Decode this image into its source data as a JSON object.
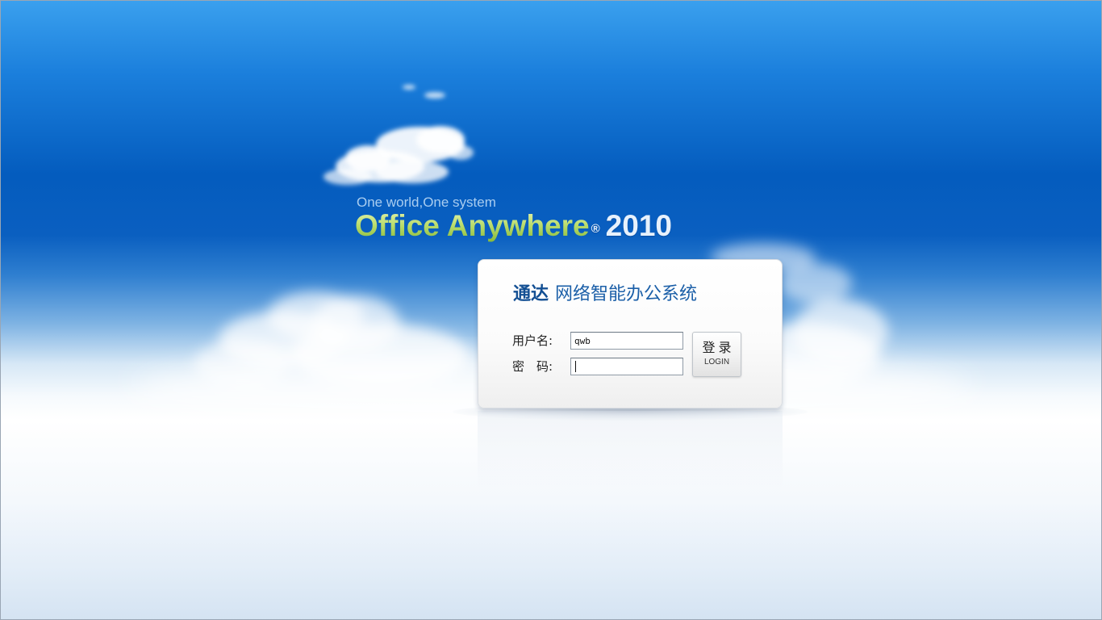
{
  "brand": {
    "tagline": "One world,One system",
    "product_name": "Office Anywhere",
    "registered_mark": "®",
    "year": "2010"
  },
  "login_card": {
    "title_brand": "通达",
    "title_system": "网络智能办公系统",
    "username_label": "用户名:",
    "password_label": "密　码:",
    "username_value": "qwb",
    "password_value": "",
    "login_button_cn": "登录",
    "login_button_en": "LOGIN"
  },
  "colors": {
    "sky_top": "#3aa0ee",
    "sky_deep": "#045cbe",
    "horizon": "#ffffff",
    "title_blue": "#1b5fa8",
    "brand_green": "#b8dc6a"
  }
}
